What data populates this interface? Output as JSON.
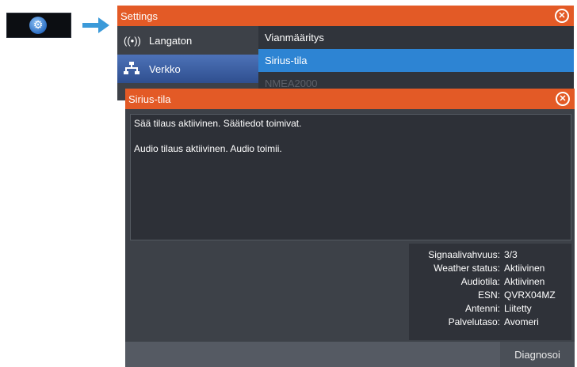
{
  "settings": {
    "title": "Settings",
    "nav": [
      {
        "label": "Langaton",
        "icon": "wireless-icon"
      },
      {
        "label": "Verkko",
        "icon": "network-icon"
      }
    ],
    "list": [
      {
        "label": "Vianmääritys"
      },
      {
        "label": "Sirius-tila"
      },
      {
        "label": "NMEA2000"
      }
    ]
  },
  "dialog": {
    "title": "Sirius-tila",
    "messages": [
      "Sää tilaus aktiivinen. Säätiedot toimivat.",
      "Audio tilaus aktiivinen. Audio toimii."
    ],
    "info": [
      {
        "label": "Signaalivahvuus:",
        "value": "3/3"
      },
      {
        "label": "Weather status:",
        "value": "Aktiivinen"
      },
      {
        "label": "Audiotila:",
        "value": "Aktiivinen"
      },
      {
        "label": "ESN:",
        "value": "QVRX04MZ"
      },
      {
        "label": "Antenni:",
        "value": "Liitetty"
      },
      {
        "label": "Palvelutaso:",
        "value": "Avomeri"
      }
    ],
    "button": "Diagnosoi"
  },
  "colors": {
    "accent": "#e35a26",
    "selection": "#2d84d3",
    "arrow": "#3b9ad9"
  }
}
